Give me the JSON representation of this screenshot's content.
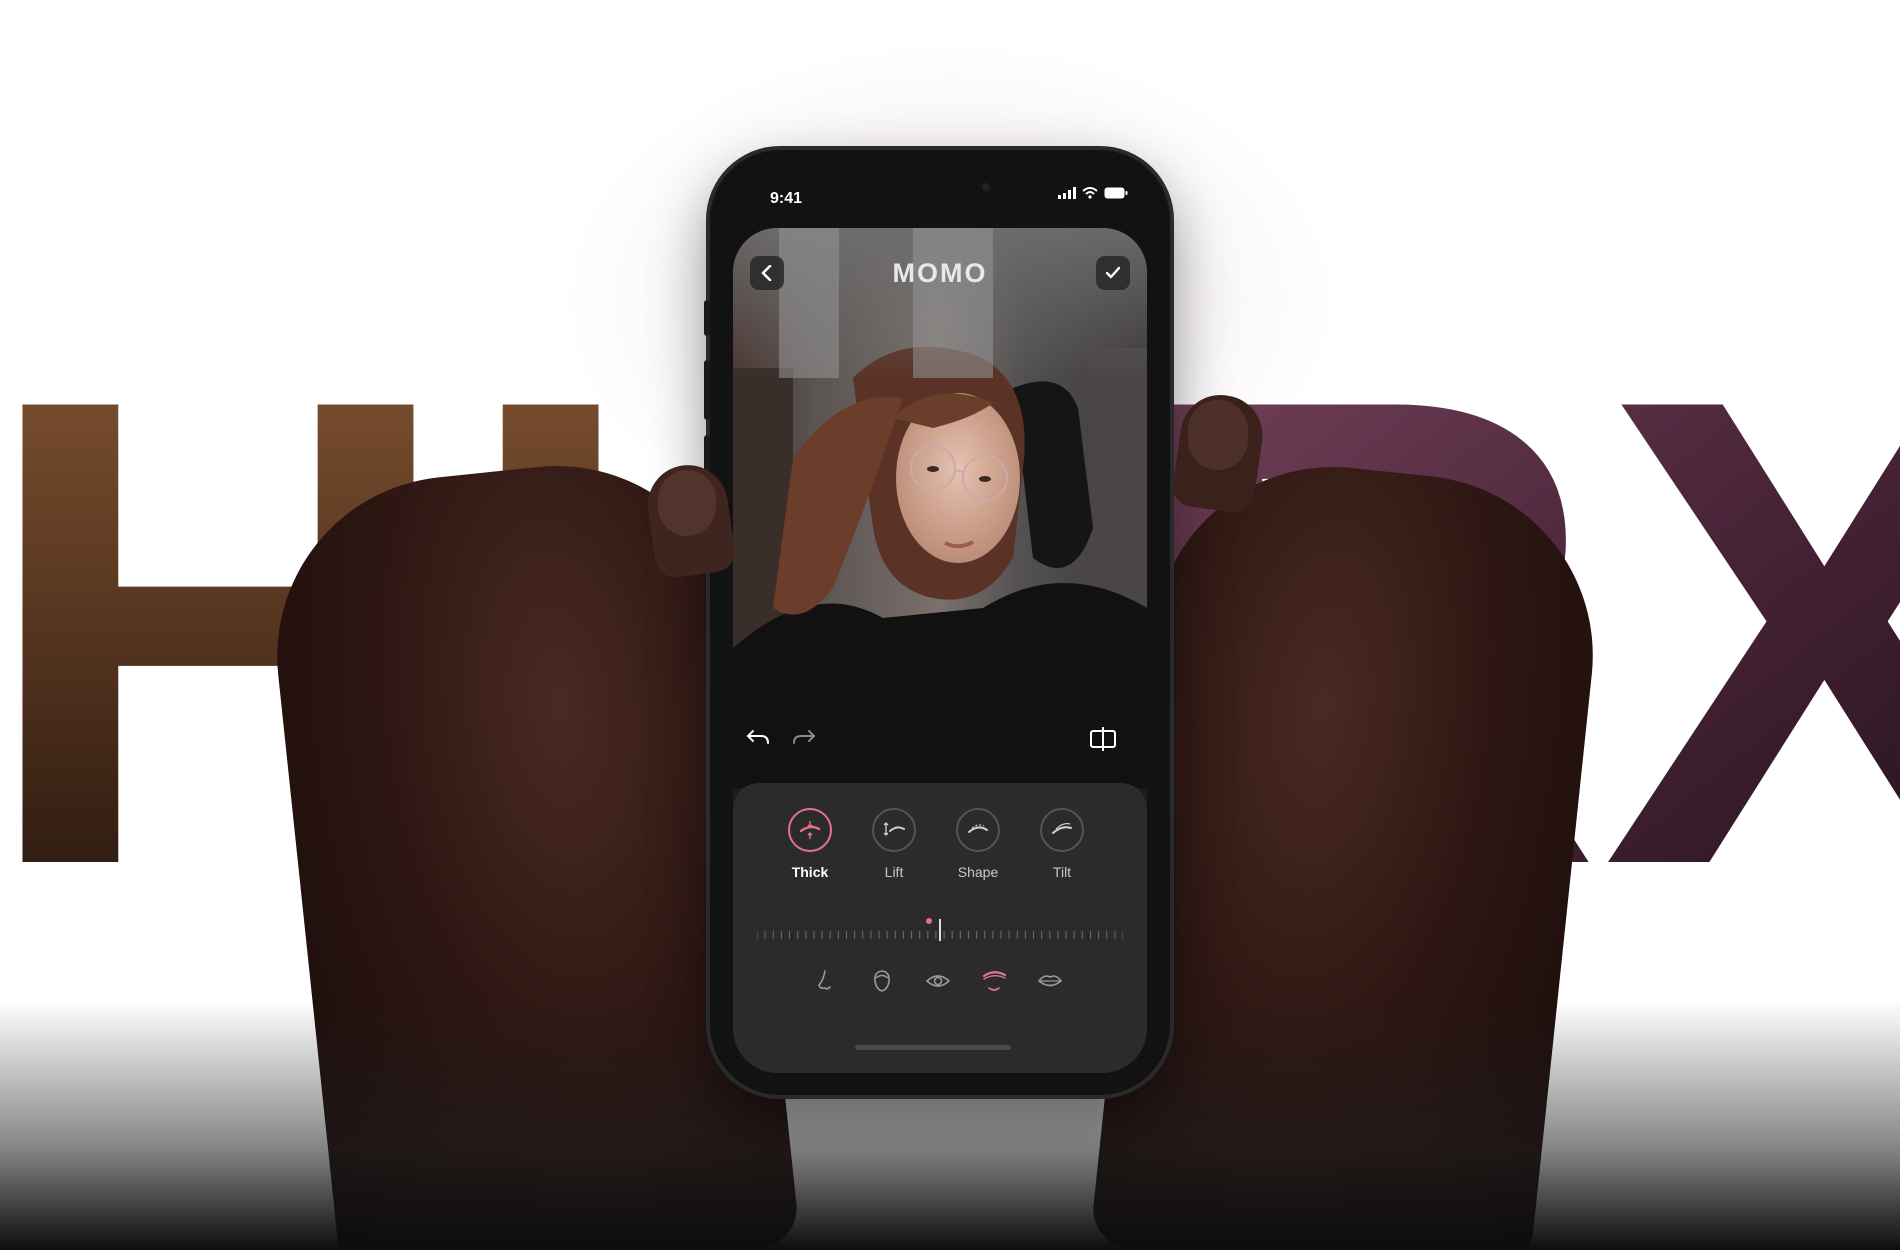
{
  "background": {
    "headline_left": "HI",
    "headline_right": "RX"
  },
  "status_bar": {
    "time": "9:41"
  },
  "app": {
    "logo": "MOMO",
    "back_icon": "chevron-left-icon",
    "confirm_icon": "checkmark-icon",
    "undo_icon": "undo-icon",
    "redo_icon": "redo-icon",
    "compare_icon": "compare-icon"
  },
  "tools": [
    {
      "label": "Thick",
      "icon": "brow-thick-icon",
      "active": true
    },
    {
      "label": "Lift",
      "icon": "brow-lift-icon",
      "active": false
    },
    {
      "label": "Shape",
      "icon": "brow-shape-icon",
      "active": false
    },
    {
      "label": "Tilt",
      "icon": "brow-tilt-icon",
      "active": false
    }
  ],
  "slider": {
    "value": 0.47
  },
  "features": [
    {
      "icon": "nose-icon",
      "active": false
    },
    {
      "icon": "face-icon",
      "active": false
    },
    {
      "icon": "eye-icon",
      "active": false
    },
    {
      "icon": "eyebrow-icon",
      "active": true
    },
    {
      "icon": "lips-icon",
      "active": false
    }
  ],
  "colors": {
    "accent": "#e4738a",
    "panel": "#2b2b2c",
    "headline_left": "#6b4325",
    "headline_right": "#5a3050"
  }
}
